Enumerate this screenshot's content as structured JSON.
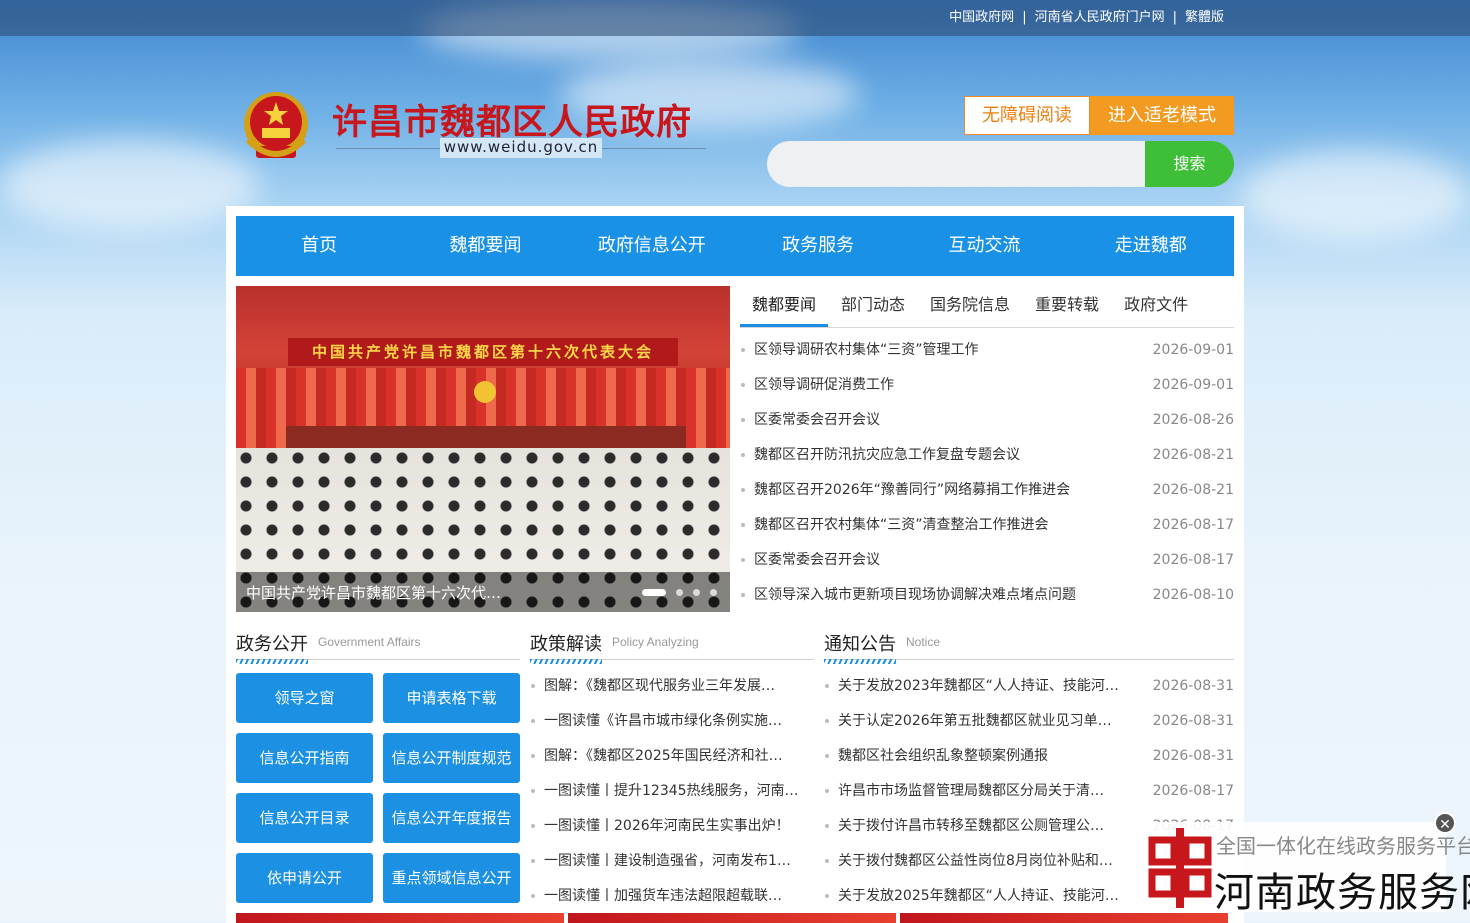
{
  "topbar": {
    "links": [
      "中国政府网",
      "河南省人民政府门户网",
      "繁體版"
    ],
    "separator": "|"
  },
  "header": {
    "site_title": "许昌市魏都区人民政府",
    "site_url": "www.weidu.gov.cn",
    "accessibility_label": "无障碍阅读",
    "elder_mode_label": "进入适老模式",
    "search_placeholder": "",
    "search_button": "搜索"
  },
  "colors": {
    "nav_blue": "#1991e6",
    "accent_orange": "#f39b21",
    "search_green": "#3fbf37",
    "title_red": "#c8161d"
  },
  "nav": {
    "items": [
      "首页",
      "魏都要闻",
      "政府信息公开",
      "政务服务",
      "互动交流",
      "走进魏都"
    ]
  },
  "slider": {
    "banner": "中国共产党许昌市魏都区第十六次代表大会",
    "caption": "中国共产党许昌市魏都区第十六次代表大会",
    "dots": 4,
    "active_dot": 1
  },
  "news": {
    "tabs": [
      "魏都要闻",
      "部门动态",
      "国务院信息",
      "重要转载",
      "政府文件"
    ],
    "active_tab": 0,
    "items": [
      {
        "title": "区领导调研农村集体“三资”管理工作",
        "date": "2026-09-01"
      },
      {
        "title": "区领导调研促消费工作",
        "date": "2026-09-01"
      },
      {
        "title": "区委常委会召开会议",
        "date": "2026-08-26"
      },
      {
        "title": "魏都区召开防汛抗灾应急工作复盘专题会议",
        "date": "2026-08-21"
      },
      {
        "title": "魏都区召开2026年“豫善同行”网络募捐工作推进会",
        "date": "2026-08-21"
      },
      {
        "title": "魏都区召开农村集体“三资”清查整治工作推进会",
        "date": "2026-08-17"
      },
      {
        "title": "区委常委会召开会议",
        "date": "2026-08-17"
      },
      {
        "title": "区领导深入城市更新项目现场协调解决难点堵点问题",
        "date": "2026-08-10"
      }
    ]
  },
  "gov_affairs": {
    "title": "政务公开",
    "subtitle": "Government Affairs",
    "buttons": [
      "领导之窗",
      "申请表格下载",
      "信息公开指南",
      "信息公开制度规范",
      "信息公开目录",
      "信息公开年度报告",
      "依申请公开",
      "重点领域信息公开"
    ]
  },
  "policy": {
    "title": "政策解读",
    "subtitle": "Policy Analyzing",
    "items": [
      "图解：《魏都区现代服务业三年发展…",
      "一图读懂《许昌市城市绿化条例实施…",
      "图解：《魏都区2025年国民经济和社…",
      "一图读懂丨提升12345热线服务，河南…",
      "一图读懂丨2026年河南民生实事出炉！",
      "一图读懂丨建设制造强省，河南发布1…",
      "一图读懂丨加强货车违法超限超载联…"
    ]
  },
  "notices": {
    "title": "通知公告",
    "subtitle": "Notice",
    "items": [
      {
        "title": "关于发放2023年魏都区“人人持证、技能河…",
        "date": "2026-08-31"
      },
      {
        "title": "关于认定2026年第五批魏都区就业见习单…",
        "date": "2026-08-31"
      },
      {
        "title": "魏都区社会组织乱象整顿案例通报",
        "date": "2026-08-31"
      },
      {
        "title": "许昌市市场监督管理局魏都区分局关于清…",
        "date": "2026-08-17"
      },
      {
        "title": "关于拨付许昌市转移至魏都区公厕管理公…",
        "date": "2026-08-17"
      },
      {
        "title": "关于拨付魏都区公益性岗位8月岗位补贴和…",
        "date": ""
      },
      {
        "title": "关于发放2025年魏都区“人人持证、技能河…",
        "date": ""
      }
    ]
  },
  "float_ad": {
    "line1": "全国一体化在线政务服务平台",
    "line2": "河南政务服务网",
    "close": "✕"
  }
}
